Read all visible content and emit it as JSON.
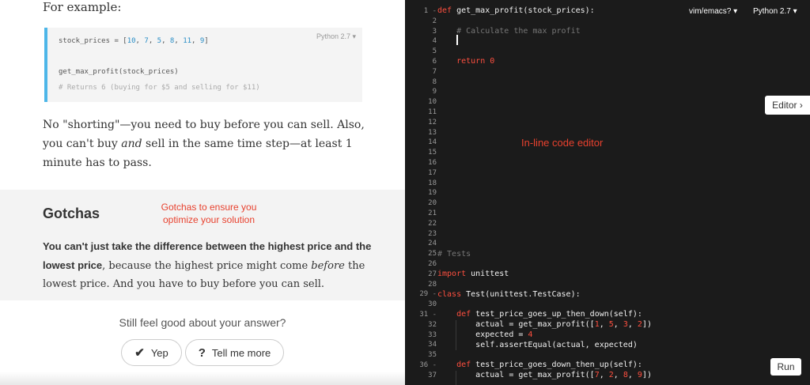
{
  "left": {
    "for_example": "For example:",
    "code": {
      "lang": "Python 2.7 ▾",
      "line1_a": "stock_prices = [",
      "line1_nums": [
        "10",
        "7",
        "5",
        "8",
        "11",
        "9"
      ],
      "line2": "get_max_profit(stock_prices)",
      "line3": "# Returns 6 (buying for $5 and selling for $11)"
    },
    "para1_part1": "No \"shorting\"—you need to buy before you can sell. Also, you can't buy ",
    "para1_em": "and",
    "para1_part2": " sell in the same time step—at least 1 minute has to pass.",
    "gotchas_title": "Gotchas",
    "gotchas_annotation_line1": "Gotchas to ensure you",
    "gotchas_annotation_line2": "optimize your solution",
    "gotcha_bold": "You can't just take the difference between the highest price and the lowest price",
    "gotcha_mid": ", because the highest price might come ",
    "gotcha_em": "before",
    "gotcha_end": " the lowest price. And you have to buy before you can sell.",
    "feel_question": "Still feel good about your answer?",
    "yep_label": "Yep",
    "tell_more_label": "Tell me more"
  },
  "editor": {
    "keymap_menu": "vim/emacs? ▾",
    "lang_menu": "Python 2.7 ▾",
    "inline_label": "In-line code editor",
    "editor_button": "Editor ›",
    "run_button": "Run",
    "line_numbers": [
      "1",
      "2",
      "3",
      "4",
      "5",
      "6",
      "7",
      "8",
      "9",
      "10",
      "11",
      "12",
      "13",
      "14",
      "15",
      "16",
      "17",
      "18",
      "19",
      "20",
      "21",
      "22",
      "23",
      "24",
      "25",
      "26",
      "27",
      "28",
      "29",
      "30",
      "31",
      "32",
      "33",
      "34",
      "35",
      "36",
      "37"
    ],
    "lines": {
      "l1_kw": "def",
      "l1_rest": " get_max_profit(stock_prices):",
      "l3": "    # Calculate the max profit",
      "l6_kw": "return",
      "l6_num": "0",
      "l25": "# Tests",
      "l27_kw": "import",
      "l27_rest": " unittest",
      "l29_kw": "class",
      "l29_rest": " Test(unittest.TestCase):",
      "l31_kw": "def",
      "l31_rest": " test_price_goes_up_then_down(self):",
      "l32_a": "actual = get_max_profit([",
      "l32_nums": [
        "1",
        "5",
        "3",
        "2"
      ],
      "l33_a": "expected = ",
      "l33_num": "4",
      "l34": "self.assertEqual(actual, expected)",
      "l36_kw": "def",
      "l36_rest": " test_price_goes_down_then_up(self):",
      "l37_a": "actual = get_max_profit([",
      "l37_nums": [
        "7",
        "2",
        "8",
        "9"
      ]
    }
  }
}
